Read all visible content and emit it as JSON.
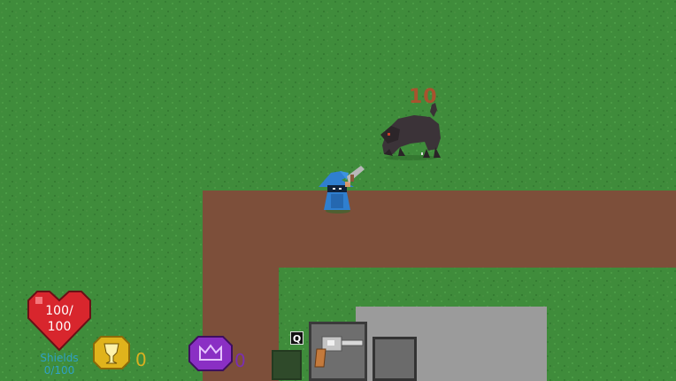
{
  "hud": {
    "health_line1": "100/",
    "health_line2": "100",
    "shields_label": "Shields",
    "shields_value": "0/100",
    "gold_count": "0",
    "gem_count": "0",
    "ability_key": "Q"
  },
  "world": {
    "damage_number": "10"
  },
  "icons": {
    "heart": "heart-icon",
    "gold": "gold-chalice-coin-icon",
    "purple": "purple-crown-gem-icon",
    "weapon": "revolver-icon"
  },
  "colors": {
    "grass": "#3e8a3a",
    "dirt_path": "#7d4f3a",
    "stone": "#9b9b9b",
    "heart": "#d8262d",
    "gold": "#d9b020",
    "purple": "#7a2fb0",
    "shields_text": "#2fa0c4",
    "damage_text": "#a8532e"
  }
}
